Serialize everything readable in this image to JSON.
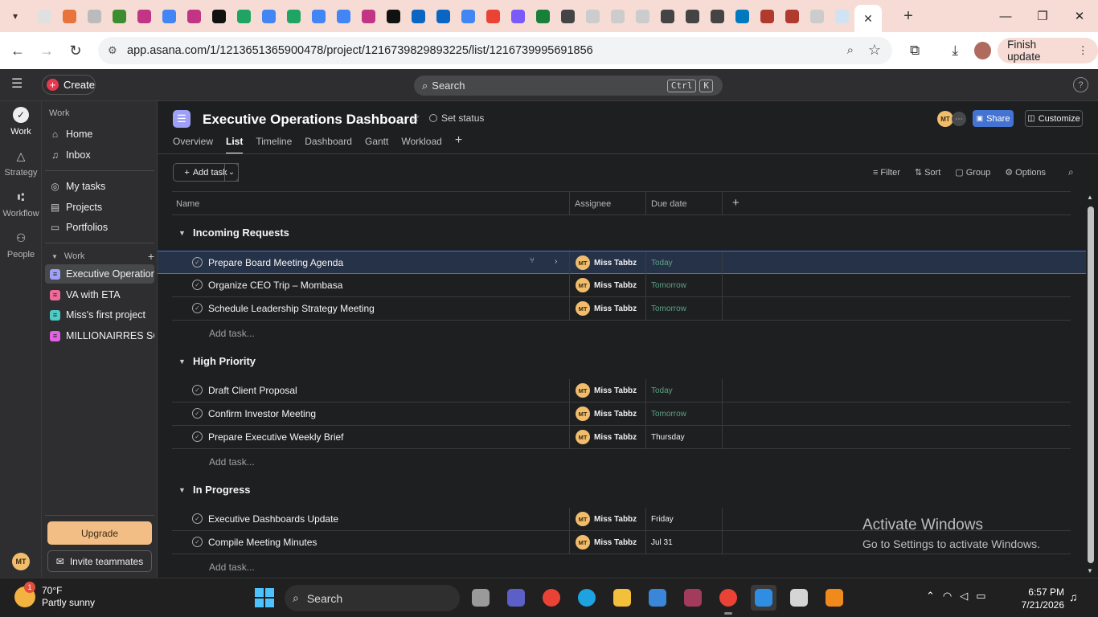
{
  "browser": {
    "url": "app.asana.com/1/1213651365900478/project/1216739829893225/list/1216739995691856",
    "finish_update": "Finish update",
    "tab_colors": [
      "#e0e0e0",
      "#e8743b",
      "#bbbbbb",
      "#3c8d2f",
      "#c13584",
      "#4285f4",
      "#c13584",
      "#111111",
      "#1fa463",
      "#4285f4",
      "#1fa463",
      "#4285f4",
      "#4285f4",
      "#c13584",
      "#111111",
      "#0a66c2",
      "#0a66c2",
      "#4285f4",
      "#ea4335",
      "#7a5af8",
      "#188038",
      "#444444",
      "#cccccc",
      "#cccccc",
      "#cccccc",
      "#444444",
      "#444444",
      "#444444",
      "#0079bf",
      "#b03a2e",
      "#b03a2e",
      "#cccccc",
      "#cfe3f3"
    ]
  },
  "asana": {
    "create_label": "Create",
    "search_placeholder": "Search",
    "shortcut_keys": [
      "Ctrl",
      "K"
    ],
    "help": "?",
    "rail": {
      "items": [
        {
          "label": "Work",
          "icon": "check-circle-icon"
        },
        {
          "label": "Strategy",
          "icon": "triangle-icon"
        },
        {
          "label": "Workflow",
          "icon": "workflow-icon"
        },
        {
          "label": "People",
          "icon": "people-icon"
        }
      ],
      "avatar": "MT"
    },
    "sidebar": {
      "section": "Work",
      "top_items": [
        {
          "label": "Home",
          "icon": "home-icon"
        },
        {
          "label": "Inbox",
          "icon": "bell-icon"
        }
      ],
      "mid_items": [
        {
          "label": "My tasks",
          "icon": "check-circle-icon"
        },
        {
          "label": "Projects",
          "icon": "clipboard-icon"
        },
        {
          "label": "Portfolios",
          "icon": "folder-icon"
        }
      ],
      "work_header": "Work",
      "projects": [
        {
          "label": "Executive Operation...",
          "color": "#9ea0f7"
        },
        {
          "label": "VA with ETA",
          "color": "#f06a99"
        },
        {
          "label": "Miss's first project",
          "color": "#4ecbc4"
        },
        {
          "label": "MILLIONAIRRES SQ...",
          "color": "#e362e3"
        }
      ],
      "upgrade": "Upgrade",
      "invite": "Invite teammates"
    },
    "project": {
      "title": "Executive Operations Dashboard",
      "set_status": "Set status",
      "member_initials": "MT",
      "share": "Share",
      "customize": "Customize",
      "tabs": [
        "Overview",
        "List",
        "Timeline",
        "Dashboard",
        "Gantt",
        "Workload"
      ],
      "active_tab": "List",
      "add_task": "Add task",
      "view_options": [
        "Filter",
        "Sort",
        "Group",
        "Options"
      ],
      "columns": [
        "Name",
        "Assignee",
        "Due date"
      ]
    },
    "sections": [
      {
        "title": "Incoming Requests",
        "tasks": [
          {
            "name": "Prepare Board Meeting Agenda",
            "assignee": "Miss Tabbz",
            "initials": "MT",
            "due": "Today",
            "due_color": "#5da283"
          },
          {
            "name": "Organize CEO Trip – Mombasa",
            "assignee": "Miss Tabbz",
            "initials": "MT",
            "due": "Tomorrow",
            "due_color": "#5da283"
          },
          {
            "name": "Schedule Leadership Strategy Meeting",
            "assignee": "Miss Tabbz",
            "initials": "MT",
            "due": "Tomorrow",
            "due_color": "#5da283"
          }
        ],
        "add_task": "Add task..."
      },
      {
        "title": "High Priority",
        "tasks": [
          {
            "name": "Draft Client Proposal",
            "assignee": "Miss Tabbz",
            "initials": "MT",
            "due": "Today",
            "due_color": "#5da283"
          },
          {
            "name": "Confirm Investor Meeting",
            "assignee": "Miss Tabbz",
            "initials": "MT",
            "due": "Tomorrow",
            "due_color": "#5da283"
          },
          {
            "name": "Prepare Executive Weekly Brief",
            "assignee": "Miss Tabbz",
            "initials": "MT",
            "due": "Thursday",
            "due_color": "#f0f0f0"
          }
        ],
        "add_task": "Add task..."
      },
      {
        "title": "In Progress",
        "tasks": [
          {
            "name": "Executive Dashboards Update",
            "assignee": "Miss Tabbz",
            "initials": "MT",
            "due": "Friday",
            "due_color": "#f0f0f0"
          },
          {
            "name": "Compile Meeting Minutes",
            "assignee": "Miss Tabbz",
            "initials": "MT",
            "due": "Jul 31",
            "due_color": "#f0f0f0"
          }
        ],
        "add_task": "Add task..."
      }
    ]
  },
  "watermark": {
    "line1": "Activate Windows",
    "line2": "Go to Settings to activate Windows."
  },
  "taskbar": {
    "weather_temp": "70°F",
    "weather_desc": "Partly sunny",
    "weather_badge": "1",
    "search": "Search",
    "time": "6:57 PM",
    "date": "7/21/2026"
  }
}
